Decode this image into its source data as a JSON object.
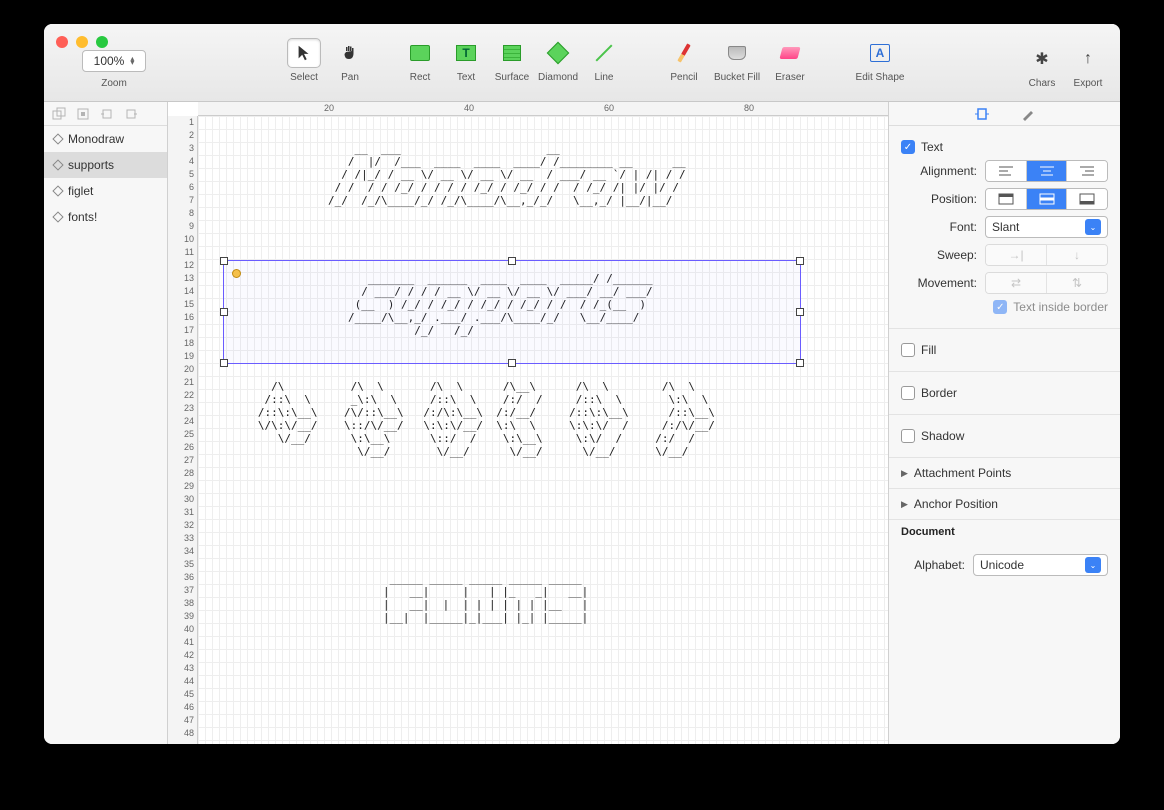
{
  "toolbar": {
    "zoom_value": "100%",
    "zoom_label": "Zoom",
    "tools": {
      "select": "Select",
      "pan": "Pan",
      "rect": "Rect",
      "text": "Text",
      "surface": "Surface",
      "diamond": "Diamond",
      "line": "Line",
      "pencil": "Pencil",
      "bucket": "Bucket Fill",
      "eraser": "Eraser",
      "edit_shape": "Edit Shape",
      "chars": "Chars",
      "export": "Export"
    }
  },
  "ruler_top": {
    "m20": "20",
    "m40": "40",
    "m60": "60",
    "m80": "80"
  },
  "ruler_left_max": 48,
  "layers": [
    {
      "name": "Monodraw",
      "selected": false
    },
    {
      "name": "supports",
      "selected": true
    },
    {
      "name": "figlet",
      "selected": false
    },
    {
      "name": "fonts!",
      "selected": false
    }
  ],
  "ascii_art": {
    "monodraw": "    __  ___                      __                  \n   /  |/  /___  ____  ____  ____/ /________ __      __\n  / /|_/ / __ \\/ __ \\/ __ \\/ __  / ___/ __ `/ | /| / /\n / /  / / /_/ / / / / /_/ / /_/ / /  / /_/ /| |/ |/ / \n/_/  /_/\\____/_/ /_/\\____/\\__,_/_/   \\__,_/ |__/|__/  ",
    "supports": "   _______  ______  ____  ____  _____/ /______\n  / ___/ / / / __ \\/ __ \\/ __ \\/ ___/ __/ ___/\n (__  ) /_/ / /_/ / /_/ / /_/ / /  / /_(__  ) \n/____/\\__,_/ .___/ .___/\\____/_/   \\__/____/  \n          /_/   /_/                            ",
    "figlet": "     /\\          /\\  \\       /\\  \\      /\\__\\      /\\  \\        /\\  \\  \n    /::\\  \\      _\\:\\  \\     /::\\  \\    /:/  /     /::\\  \\       \\:\\  \\ \n   /::\\:\\__\\    /\\/::\\__\\   /:/\\:\\__\\  /:/__/     /::\\:\\__\\      /::\\__\\\n   \\/\\:\\/__/    \\::/\\/__/   \\:\\:\\/__/  \\:\\  \\     \\:\\:\\/  /     /:/\\/__/\n      \\/__/      \\:\\__\\      \\::/  /    \\:\\__\\     \\:\\/  /     /:/  /   \n                  \\/__/       \\/__/      \\/__/      \\/__/      \\/__/    ",
    "fonts": " _____ _____ _____ _____ _____ \n|   __|     |   | |_   _|   __|\n|   __|  |  | | | | | | |__   |\n|__|  |_____|_|___| |_| |_____|\n                               "
  },
  "inspector": {
    "text_checkbox": "Text",
    "alignment_label": "Alignment:",
    "position_label": "Position:",
    "font_label": "Font:",
    "font_value": "Slant",
    "sweep_label": "Sweep:",
    "movement_label": "Movement:",
    "text_inside_border": "Text inside border",
    "fill": "Fill",
    "border": "Border",
    "shadow": "Shadow",
    "attachment": "Attachment Points",
    "anchor": "Anchor Position",
    "document": "Document",
    "alphabet_label": "Alphabet:",
    "alphabet_value": "Unicode"
  }
}
